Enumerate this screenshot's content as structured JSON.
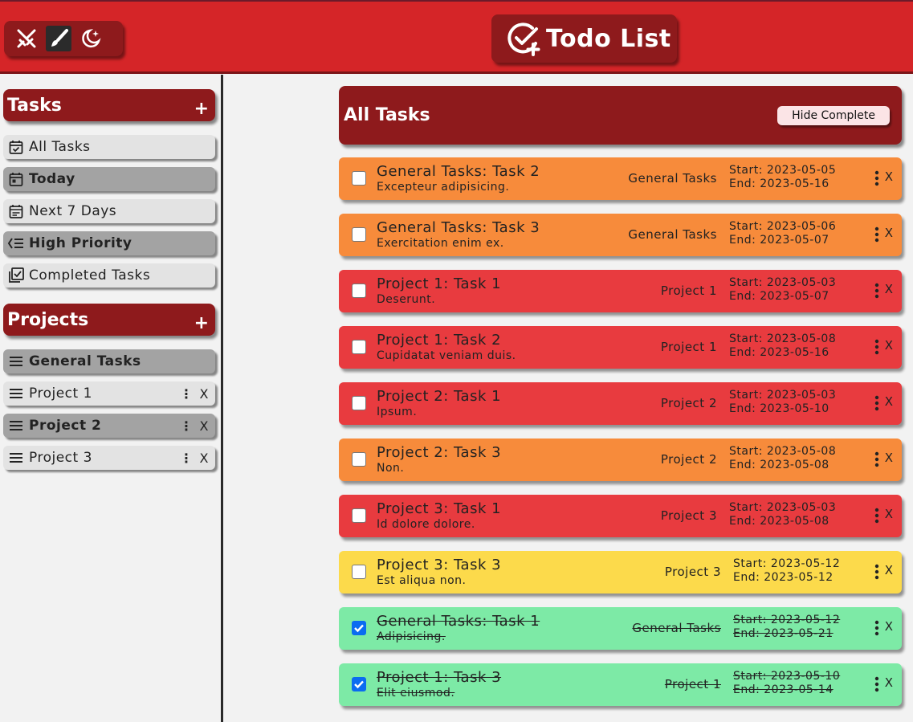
{
  "header": {
    "title": "Todo List",
    "theme_buttons": [
      {
        "icon": "swords-icon",
        "active": false
      },
      {
        "icon": "brush-icon",
        "active": true
      },
      {
        "icon": "moon-stars-icon",
        "active": false
      }
    ]
  },
  "sidebar": {
    "tasks_heading": "Tasks",
    "tasks_add": "+",
    "task_filters": [
      {
        "label": "All Tasks",
        "icon": "calendar-check-icon"
      },
      {
        "label": "Today",
        "icon": "calendar-today-icon"
      },
      {
        "label": "Next 7 Days",
        "icon": "calendar-week-icon"
      },
      {
        "label": "High Priority",
        "icon": "priority-list-icon"
      },
      {
        "label": "Completed Tasks",
        "icon": "checklist-icon"
      }
    ],
    "projects_heading": "Projects",
    "projects_add": "+",
    "projects": [
      {
        "label": "General Tasks",
        "menu": "",
        "delete": ""
      },
      {
        "label": "Project 1",
        "menu": "⋮",
        "delete": "X"
      },
      {
        "label": "Project 2",
        "menu": "⋮",
        "delete": "X"
      },
      {
        "label": "Project 3",
        "menu": "⋮",
        "delete": "X"
      }
    ]
  },
  "main": {
    "title": "All Tasks",
    "hide_complete_label": "Hide Complete",
    "tasks": [
      {
        "title": "General Tasks: Task 2",
        "desc": "Excepteur adipisicing.",
        "project": "General Tasks",
        "start": "Start: 2023-05-05",
        "end": "End: 2023-05-16",
        "priority": "orange",
        "done": false,
        "delete": "X"
      },
      {
        "title": "General Tasks: Task 3",
        "desc": "Exercitation enim ex.",
        "project": "General Tasks",
        "start": "Start: 2023-05-06",
        "end": "End: 2023-05-07",
        "priority": "orange",
        "done": false,
        "delete": "X"
      },
      {
        "title": "Project 1: Task 1",
        "desc": "Deserunt.",
        "project": "Project 1",
        "start": "Start: 2023-05-03",
        "end": "End: 2023-05-07",
        "priority": "red",
        "done": false,
        "delete": "X"
      },
      {
        "title": "Project 1: Task 2",
        "desc": "Cupidatat veniam duis.",
        "project": "Project 1",
        "start": "Start: 2023-05-08",
        "end": "End: 2023-05-16",
        "priority": "red",
        "done": false,
        "delete": "X"
      },
      {
        "title": "Project 2: Task 1",
        "desc": "Ipsum.",
        "project": "Project 2",
        "start": "Start: 2023-05-03",
        "end": "End: 2023-05-10",
        "priority": "red",
        "done": false,
        "delete": "X"
      },
      {
        "title": "Project 2: Task 3",
        "desc": "Non.",
        "project": "Project 2",
        "start": "Start: 2023-05-08",
        "end": "End: 2023-05-08",
        "priority": "orange",
        "done": false,
        "delete": "X"
      },
      {
        "title": "Project 3: Task 1",
        "desc": "Id dolore dolore.",
        "project": "Project 3",
        "start": "Start: 2023-05-03",
        "end": "End: 2023-05-08",
        "priority": "red",
        "done": false,
        "delete": "X"
      },
      {
        "title": "Project 3: Task 3",
        "desc": "Est aliqua non.",
        "project": "Project 3",
        "start": "Start: 2023-05-12",
        "end": "End: 2023-05-12",
        "priority": "yellow",
        "done": false,
        "delete": "X"
      },
      {
        "title": "General Tasks: Task 1",
        "desc": "Adipisicing.",
        "project": "General Tasks",
        "start": "Start: 2023-05-12",
        "end": "End: 2023-05-21",
        "priority": "green",
        "done": true,
        "delete": "X"
      },
      {
        "title": "Project 1: Task 3",
        "desc": "Elit eiusmod.",
        "project": "Project 1",
        "start": "Start: 2023-05-10",
        "end": "End: 2023-05-14",
        "priority": "green",
        "done": true,
        "delete": "X"
      }
    ]
  },
  "colors": {
    "header_red": "#d52528",
    "dark_red": "#8e1a1c",
    "priority_red": "#e83b3f",
    "priority_orange": "#f78b3b",
    "priority_yellow": "#fcda4b",
    "complete_green": "#7deaa6",
    "checkbox_blue": "#0b6cf0"
  }
}
